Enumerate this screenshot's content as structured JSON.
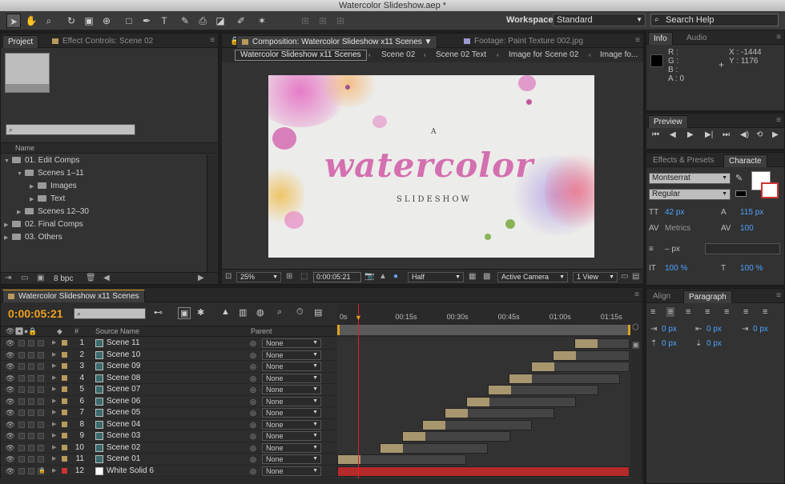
{
  "window": {
    "title": "Watercolor Slideshow.aep *"
  },
  "workspace": {
    "label": "Workspace:",
    "value": "Standard"
  },
  "search_help": {
    "placeholder": "Search Help"
  },
  "project_panel": {
    "tabs": [
      "Project",
      "Effect Controls: Scene 02"
    ],
    "column_name": "Name",
    "tree": [
      {
        "label": "01. Edit Comps",
        "level": 0,
        "expanded": true
      },
      {
        "label": "Scenes 1–11",
        "level": 1,
        "expanded": true
      },
      {
        "label": "Images",
        "level": 2,
        "expanded": false
      },
      {
        "label": "Text",
        "level": 2,
        "expanded": false
      },
      {
        "label": "Scenes 12–30",
        "level": 1,
        "expanded": false
      },
      {
        "label": "02. Final Comps",
        "level": 0,
        "expanded": false
      },
      {
        "label": "03. Others",
        "level": 0,
        "expanded": false
      }
    ],
    "bpc": "8 bpc"
  },
  "composition_panel": {
    "tabs": [
      "Composition: Watercolor Slideshow x11 Scenes",
      "Footage: Paint Texture 002.jpg"
    ],
    "breadcrumbs": [
      "Watercolor Slideshow x11 Scenes",
      "Scene 02",
      "Scene 02 Text",
      "Image for Scene 02",
      "Image fo..."
    ],
    "artwork": {
      "line1": "A",
      "main": "watercolor",
      "line3": "SLIDESHOW"
    },
    "zoom": "25%",
    "timecode": "0:00:05:21",
    "resolution": "Half",
    "camera": "Active Camera",
    "views": "1 View"
  },
  "info_panel": {
    "tabs": [
      "Info",
      "Audio"
    ],
    "r": "R :",
    "g": "G :",
    "b": "B :",
    "a": "A : 0",
    "x": "X : -1444",
    "y": "Y : 1176"
  },
  "preview_panel": {
    "title": "Preview"
  },
  "character_panel": {
    "tabs": [
      "Effects & Presets",
      "Characte"
    ],
    "font": "Montserrat",
    "style": "Regular",
    "size": "42 px",
    "leading": "115 px",
    "kerning": "Metrics",
    "tracking": "100",
    "stroke": "– px",
    "vscale": "100 %",
    "hscale": "100 %"
  },
  "paragraph_panel": {
    "tabs": [
      "Align",
      "Paragraph"
    ],
    "indents": [
      "0 px",
      "0 px",
      "0 px",
      "0 px",
      "0 px"
    ]
  },
  "timeline": {
    "tab": "Watercolor Slideshow x11 Scenes",
    "timecode": "0:00:05:21",
    "col_source": "Source Name",
    "col_parent": "Parent",
    "col_num": "#",
    "ruler": [
      "0s",
      "00:15s",
      "00:30s",
      "00:45s",
      "01:00s",
      "01:15s"
    ],
    "current_time_frac": 0.071,
    "layers": [
      {
        "num": "1",
        "name": "Scene 11",
        "parent": "None",
        "start": 0.81,
        "end": 1.0
      },
      {
        "num": "2",
        "name": "Scene 10",
        "parent": "None",
        "start": 0.735,
        "end": 1.0
      },
      {
        "num": "3",
        "name": "Scene 09",
        "parent": "None",
        "start": 0.66,
        "end": 1.0
      },
      {
        "num": "4",
        "name": "Scene 08",
        "parent": "None",
        "start": 0.585,
        "end": 0.965
      },
      {
        "num": "5",
        "name": "Scene 07",
        "parent": "None",
        "start": 0.515,
        "end": 0.89
      },
      {
        "num": "6",
        "name": "Scene 06",
        "parent": "None",
        "start": 0.44,
        "end": 0.815
      },
      {
        "num": "7",
        "name": "Scene 05",
        "parent": "None",
        "start": 0.365,
        "end": 0.74
      },
      {
        "num": "8",
        "name": "Scene 04",
        "parent": "None",
        "start": 0.29,
        "end": 0.665
      },
      {
        "num": "9",
        "name": "Scene 03",
        "parent": "None",
        "start": 0.22,
        "end": 0.59
      },
      {
        "num": "10",
        "name": "Scene 02",
        "parent": "None",
        "start": 0.145,
        "end": 0.515
      },
      {
        "num": "11",
        "name": "Scene 01",
        "parent": "None",
        "start": 0.0,
        "end": 0.44
      },
      {
        "num": "12",
        "name": "White Solid 6",
        "parent": "None",
        "start": 0.0,
        "end": 1.0,
        "solid": true
      }
    ]
  },
  "colors": {
    "accent_blue": "#4da3ff",
    "timecode_orange": "#f0a020",
    "solid_bar": "#b52a2a",
    "clip_bar": "#a8966f"
  }
}
